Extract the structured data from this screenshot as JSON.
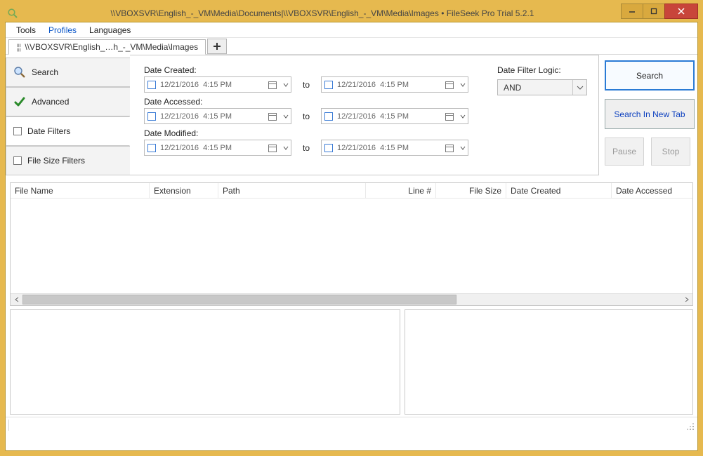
{
  "titlebar": {
    "title": "\\\\VBOXSVR\\English_-_VM\\Media\\Documents|\\\\VBOXSVR\\English_-_VM\\Media\\Images • FileSeek Pro Trial 5.2.1"
  },
  "menubar": {
    "tools": "Tools",
    "profiles": "Profiles",
    "languages": "Languages"
  },
  "tabbar": {
    "tab0": "\\\\VBOXSVR\\English_…h_-_VM\\Media\\Images"
  },
  "sidebar": {
    "search": "Search",
    "advanced": "Advanced",
    "date_filters": "Date Filters",
    "filesize_filters": "File Size Filters"
  },
  "filters": {
    "date_created_lbl": "Date Created:",
    "date_accessed_lbl": "Date Accessed:",
    "date_modified_lbl": "Date Modified:",
    "to": "to",
    "date_value": "12/21/2016",
    "time_value": "4:15 PM",
    "logic_lbl": "Date Filter Logic:",
    "logic_value": "AND"
  },
  "actions": {
    "search": "Search",
    "search_new_tab": "Search In New Tab",
    "pause": "Pause",
    "stop": "Stop"
  },
  "columns": {
    "filename": "File Name",
    "extension": "Extension",
    "path": "Path",
    "line": "Line #",
    "filesize": "File Size",
    "date_created": "Date Created",
    "date_accessed": "Date Accessed"
  }
}
